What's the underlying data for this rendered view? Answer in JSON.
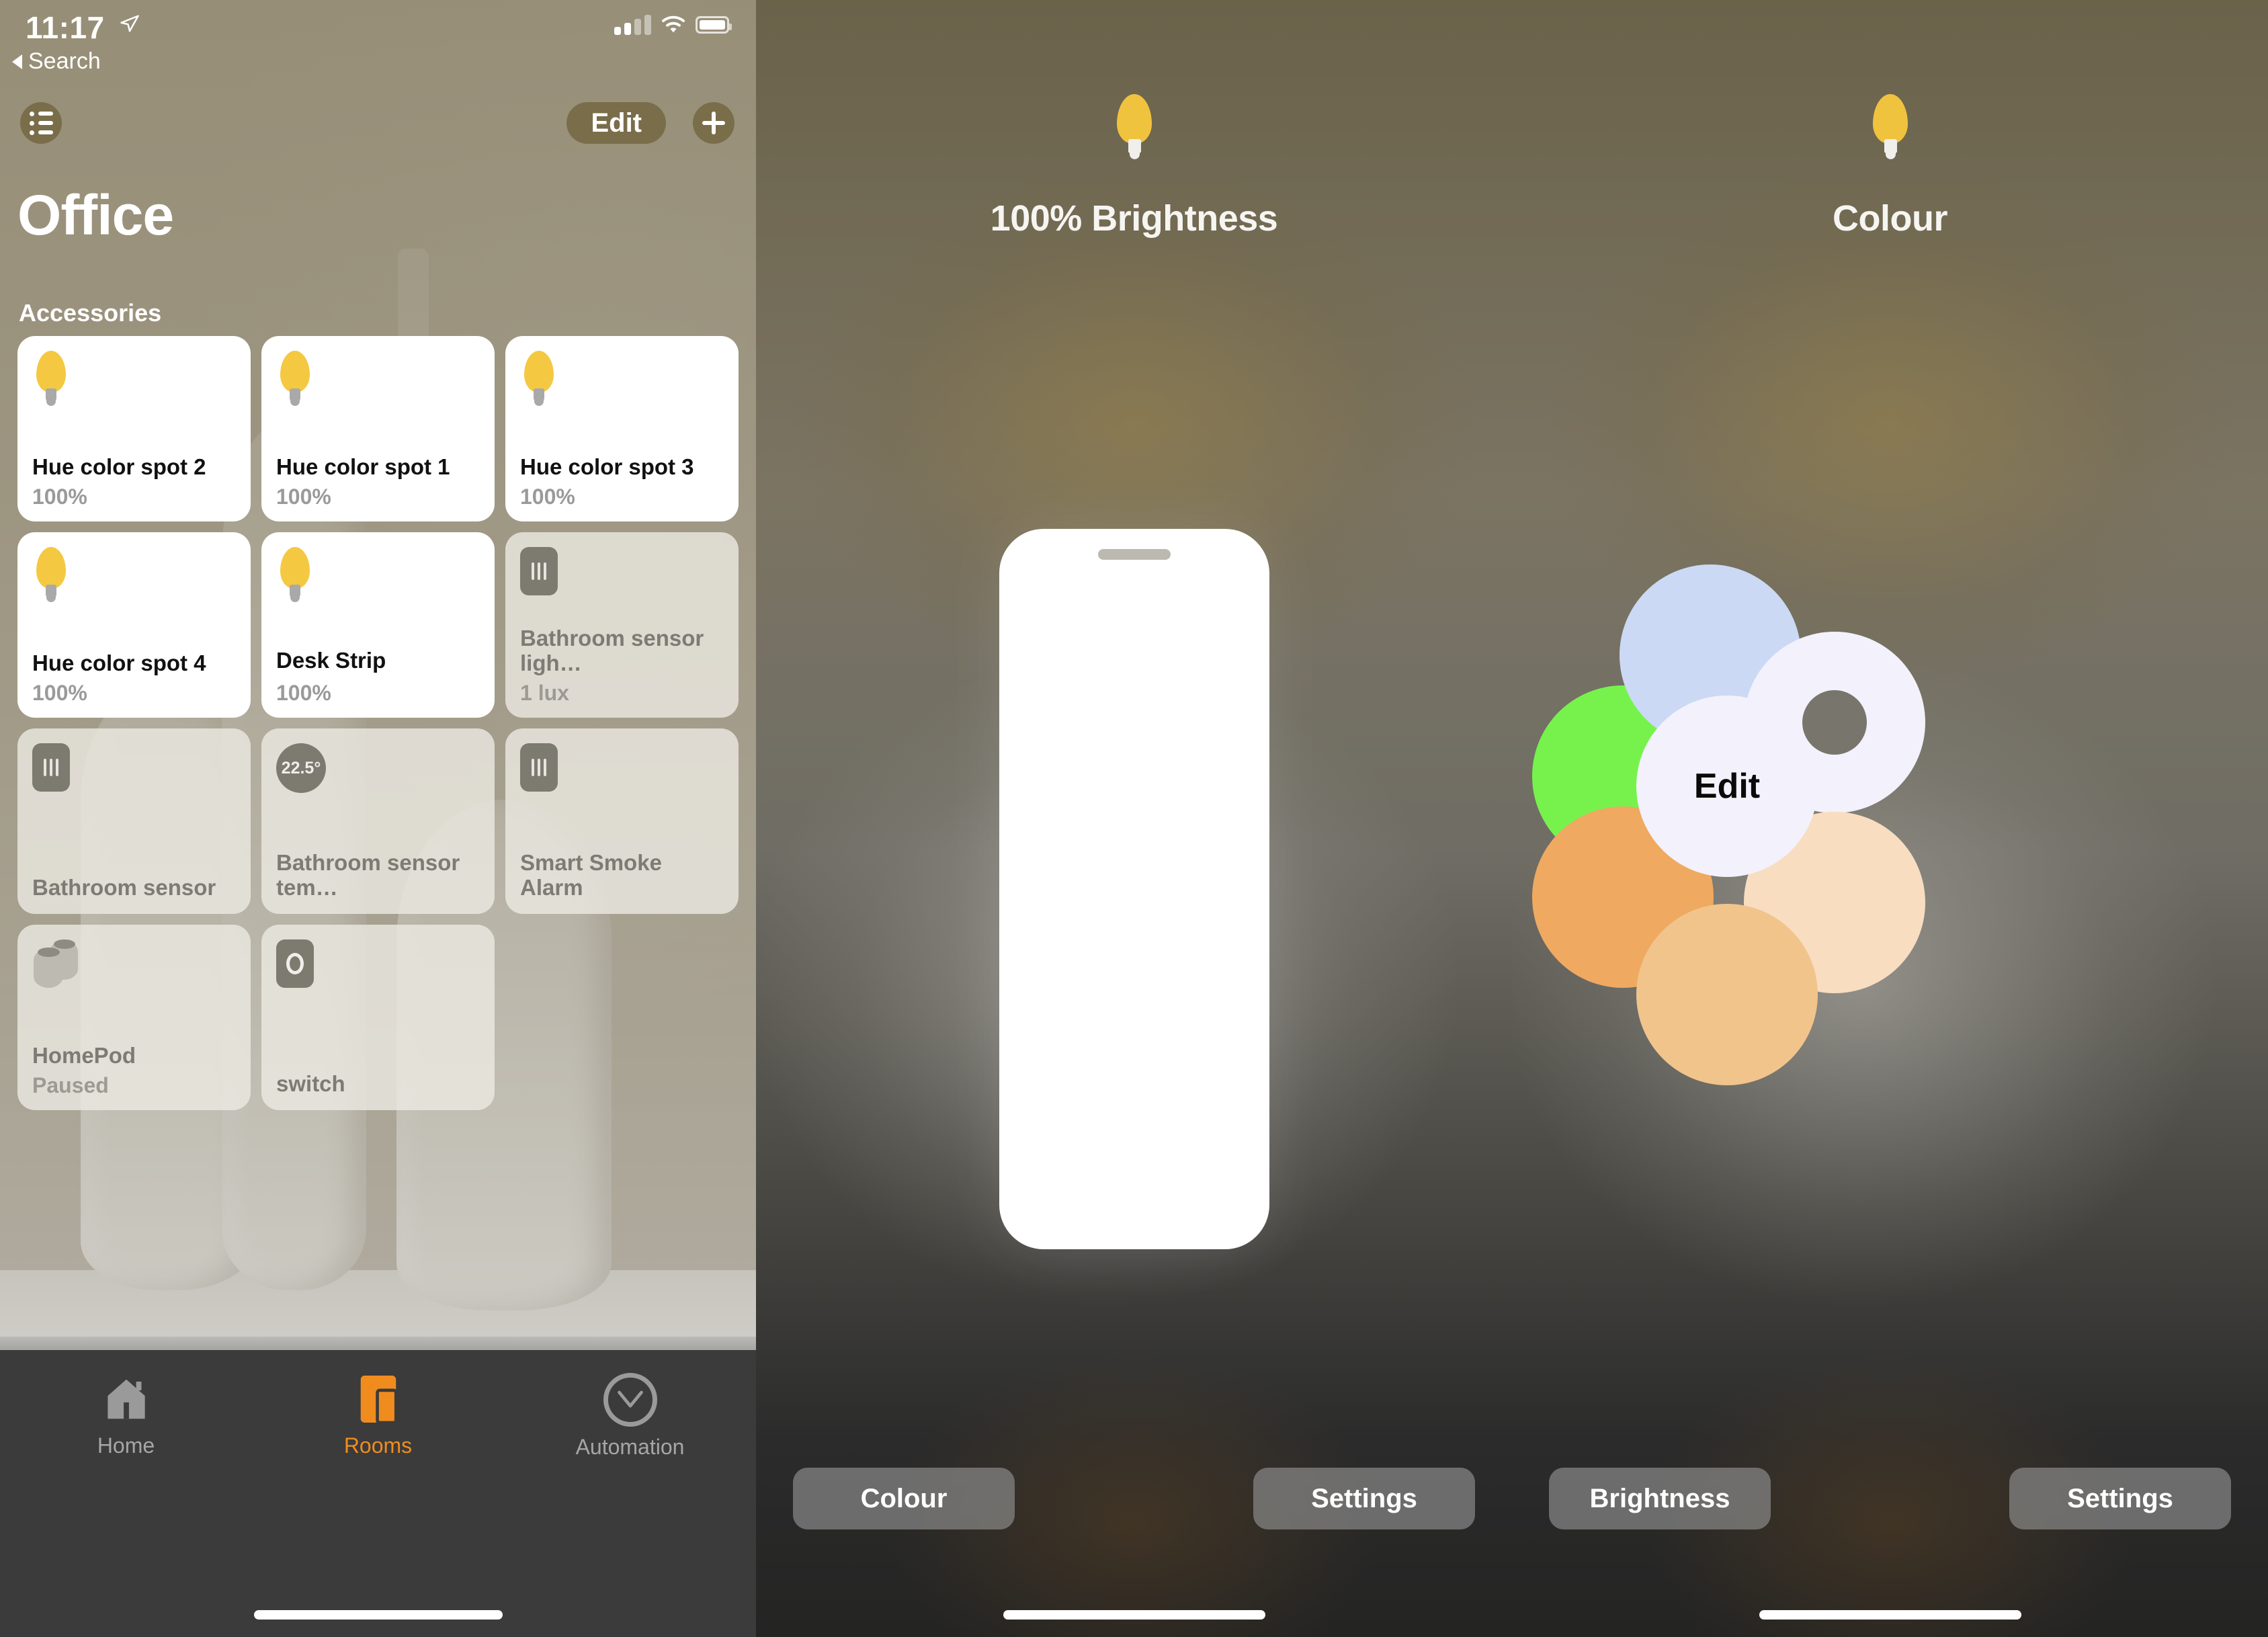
{
  "status_bar": {
    "time": "11:17",
    "location_icon": "location-arrow-icon",
    "signal_icon": "cellular-signal-icon",
    "wifi_icon": "wifi-icon",
    "battery_icon": "battery-icon"
  },
  "room_screen": {
    "back_label": "Search",
    "list_button_icon": "list-icon",
    "edit_label": "Edit",
    "add_label": "+",
    "title": "Office",
    "section_label": "Accessories",
    "accessories": [
      {
        "name": "Hue color spot 2",
        "status": "100%",
        "icon": "lightbulb-icon",
        "state": "on"
      },
      {
        "name": "Hue color spot 1",
        "status": "100%",
        "icon": "lightbulb-icon",
        "state": "on"
      },
      {
        "name": "Hue color spot 3",
        "status": "100%",
        "icon": "lightbulb-icon",
        "state": "on"
      },
      {
        "name": "Hue color spot 4",
        "status": "100%",
        "icon": "lightbulb-icon",
        "state": "on"
      },
      {
        "name": "Desk Strip",
        "status": "100%",
        "icon": "lightbulb-icon",
        "state": "on"
      },
      {
        "name": "Bathroom sensor ligh…",
        "status": "1 lux",
        "icon": "sensor-icon",
        "state": "off"
      },
      {
        "name": "Bathroom sensor",
        "status": "",
        "icon": "sensor-icon",
        "state": "off"
      },
      {
        "name": "Bathroom sensor tem…",
        "status": "",
        "icon": "temperature-icon",
        "state": "off",
        "temp": "22.5°"
      },
      {
        "name": "Smart Smoke Alarm",
        "status": "",
        "icon": "sensor-icon",
        "state": "off"
      },
      {
        "name": "HomePod",
        "status": "Paused",
        "icon": "homepod-icon",
        "state": "off"
      },
      {
        "name": "switch",
        "status": "",
        "icon": "switch-icon",
        "state": "off"
      }
    ],
    "tabs": [
      {
        "label": "Home",
        "icon": "home-icon",
        "active": false
      },
      {
        "label": "Rooms",
        "icon": "rooms-icon",
        "active": true
      },
      {
        "label": "Automation",
        "icon": "automation-clock-icon",
        "active": false
      }
    ]
  },
  "brightness_screen": {
    "bulb_icon": "lightbulb-icon",
    "title": "100% Brightness",
    "slider_value": 100,
    "slider_grip_icon": "drag-handle-icon",
    "left_action": "Colour",
    "right_action": "Settings"
  },
  "colour_screen": {
    "bulb_icon": "lightbulb-icon",
    "title": "Colour",
    "edit_label": "Edit",
    "swatches": [
      {
        "name": "green",
        "color": "#77f24d"
      },
      {
        "name": "blue",
        "color": "#cbd9f5"
      },
      {
        "name": "ring",
        "color": "#f3f1fb"
      },
      {
        "name": "edit",
        "color": "#f3f1fb"
      },
      {
        "name": "orange",
        "color": "#efa961"
      },
      {
        "name": "peach",
        "color": "#f8ddc0"
      },
      {
        "name": "tan",
        "color": "#f1c48c"
      }
    ],
    "left_action": "Brightness",
    "right_action": "Settings"
  },
  "colors": {
    "accent_orange": "#f08c1e",
    "bulb_yellow": "#f5c842",
    "tabbar_bg": "#3b3b3b"
  }
}
